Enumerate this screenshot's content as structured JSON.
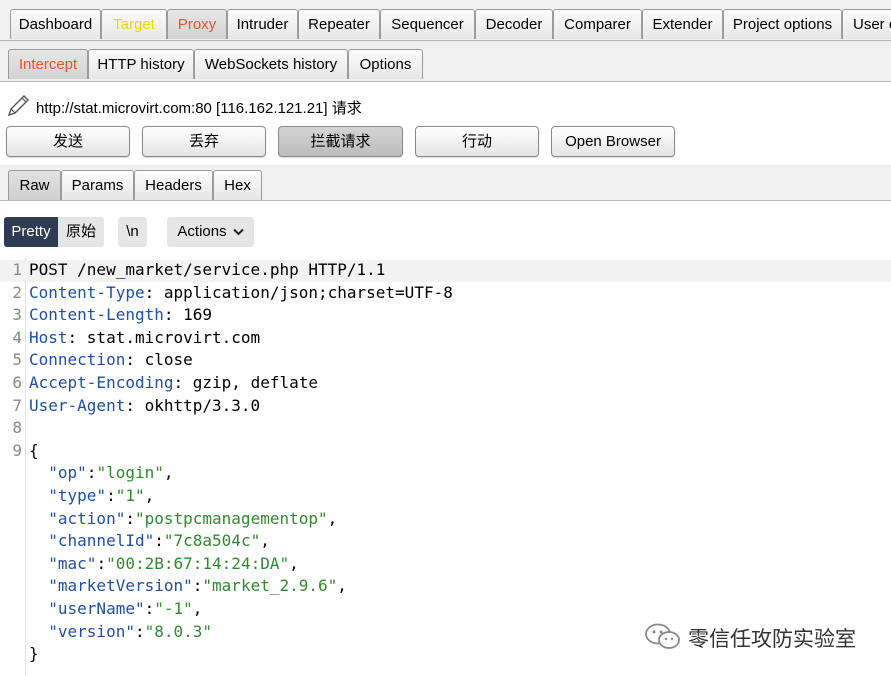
{
  "top_tabs": [
    "Dashboard",
    "Target",
    "Proxy",
    "Intruder",
    "Repeater",
    "Sequencer",
    "Decoder",
    "Comparer",
    "Extender",
    "Project options",
    "User o"
  ],
  "sub_tabs": [
    "Intercept",
    "HTTP history",
    "WebSockets history",
    "Options"
  ],
  "request_line": "http://stat.microvirt.com:80  [116.162.121.21] 请求",
  "actions": {
    "forward": "发送",
    "drop": "丢弃",
    "intercept": "拦截请求",
    "action": "行动",
    "open_browser": "Open Browser"
  },
  "view_tabs": [
    "Raw",
    "Params",
    "Headers",
    "Hex"
  ],
  "editor_toolbar": {
    "pretty": "Pretty",
    "raw": "原始",
    "newline": "\\n",
    "actions": "Actions"
  },
  "code_lines": [
    {
      "n": "1",
      "plain": "POST /new_market/service.php HTTP/1.1"
    },
    {
      "n": "2",
      "name": "Content-Type",
      "value": ": application/json;charset=UTF-8"
    },
    {
      "n": "3",
      "name": "Content-Length",
      "value": ": 169"
    },
    {
      "n": "4",
      "name": "Host",
      "value": ": stat.microvirt.com"
    },
    {
      "n": "5",
      "name": "Connection",
      "value": ": close"
    },
    {
      "n": "6",
      "name": "Accept-Encoding",
      "value": ": gzip, deflate"
    },
    {
      "n": "7",
      "name": "User-Agent",
      "value": ": okhttp/3.3.0"
    },
    {
      "n": "8",
      "plain": ""
    },
    {
      "n": "9",
      "plain": "{"
    },
    {
      "n": "",
      "key": "\"op\"",
      "val": "\"login\"",
      "tail": ","
    },
    {
      "n": "",
      "key": "\"type\"",
      "val": "\"1\"",
      "tail": ","
    },
    {
      "n": "",
      "key": "\"action\"",
      "val": "\"postpcmanagementop\"",
      "tail": ","
    },
    {
      "n": "",
      "key": "\"channelId\"",
      "val": "\"7c8a504c\"",
      "tail": ","
    },
    {
      "n": "",
      "key": "\"mac\"",
      "val": "\"00:2B:67:14:24:DA\"",
      "tail": ","
    },
    {
      "n": "",
      "key": "\"marketVersion\"",
      "val": "\"market_2.9.6\"",
      "tail": ","
    },
    {
      "n": "",
      "key": "\"userName\"",
      "val": "\"-1\"",
      "tail": ","
    },
    {
      "n": "",
      "key": "\"version\"",
      "val": "\"8.0.3\"",
      "tail": ""
    },
    {
      "n": "",
      "plain": "}"
    }
  ],
  "watermark": "零信任攻防实验室",
  "colors": {
    "accent_orange": "#e8542c",
    "target_yellow": "#e8d800",
    "header_name": "#1f4fa7",
    "json_value": "#2f8a2f",
    "pretty_bg": "#2f3b52"
  }
}
